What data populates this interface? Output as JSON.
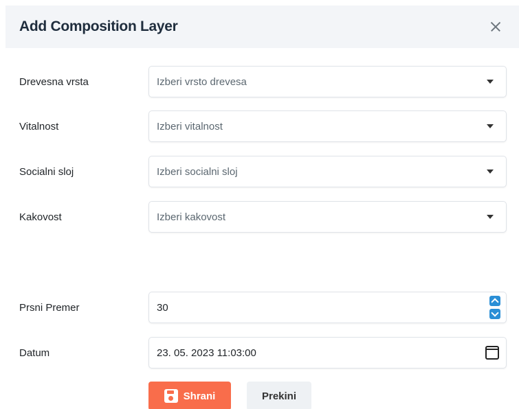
{
  "dialog": {
    "title": "Add Composition Layer",
    "close_icon": "close-icon"
  },
  "fields": {
    "tree_species": {
      "label": "Drevesna vrsta",
      "placeholder": "Izberi vrsto drevesa"
    },
    "vitality": {
      "label": "Vitalnost",
      "placeholder": "Izberi vitalnost"
    },
    "social_layer": {
      "label": "Socialni sloj",
      "placeholder": "Izberi socialni sloj"
    },
    "quality": {
      "label": "Kakovost",
      "placeholder": "Izberi kakovost"
    },
    "diameter": {
      "label": "Prsni Premer",
      "value": "30"
    },
    "date": {
      "label": "Datum",
      "value": "23. 05. 2023 11:03:00"
    }
  },
  "buttons": {
    "save_label": "Shrani",
    "cancel_label": "Prekini"
  },
  "colors": {
    "save_button": "#f96d4b",
    "spinner_accent": "#2b8fd6",
    "header_background": "#f3f5f8"
  }
}
